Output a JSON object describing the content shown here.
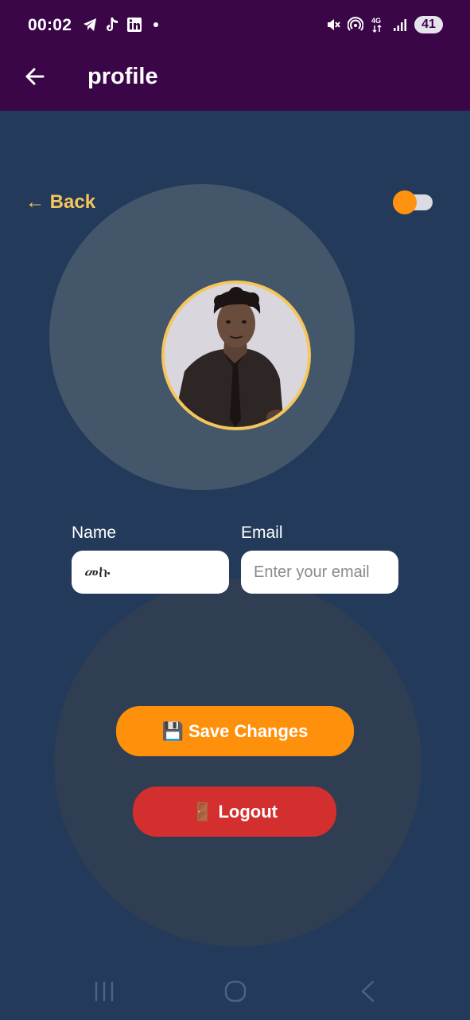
{
  "status_bar": {
    "time": "00:02",
    "battery": "41",
    "network": "4G"
  },
  "app_bar": {
    "title": "profile"
  },
  "back_link": "← Back",
  "theme_toggle": {
    "state": "on",
    "color": "#ff9210"
  },
  "form": {
    "name_label": "Name",
    "name_value": "መኩ",
    "email_label": "Email",
    "email_placeholder": "Enter your email",
    "email_value": ""
  },
  "buttons": {
    "save": {
      "emoji": "💾",
      "label": "Save Changes"
    },
    "logout": {
      "emoji": "🚪",
      "label": "Logout"
    }
  },
  "colors": {
    "header": "#3a0648",
    "background": "#233a5a",
    "accent": "#f5c75a",
    "save": "#ff900c",
    "logout": "#d32f2f"
  }
}
